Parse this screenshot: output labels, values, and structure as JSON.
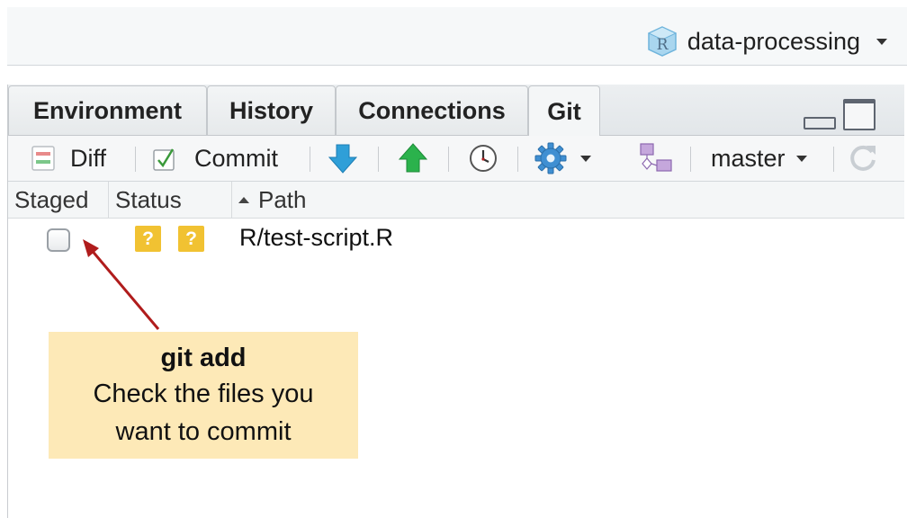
{
  "project": {
    "name": "data-processing",
    "icon": "r-project-cube-icon"
  },
  "tabs": [
    {
      "label": "Environment",
      "active": false
    },
    {
      "label": "History",
      "active": false
    },
    {
      "label": "Connections",
      "active": false
    },
    {
      "label": "Git",
      "active": true
    }
  ],
  "toolbar": {
    "diff_label": "Diff",
    "commit_label": "Commit",
    "pull_icon": "pull-arrow-down-icon",
    "push_icon": "push-arrow-up-icon",
    "history_icon": "clock-icon",
    "more_icon": "gear-icon",
    "new_branch_icon": "branch-icon",
    "branch_label": "master",
    "refresh_icon": "refresh-icon"
  },
  "table": {
    "headers": {
      "staged": "Staged",
      "status": "Status",
      "path": "Path"
    },
    "rows": [
      {
        "staged": false,
        "status": [
          "?",
          "?"
        ],
        "path": "R/test-script.R"
      }
    ]
  },
  "annotation": {
    "title": "git add",
    "line1": "Check the files you",
    "line2": "want to commit"
  },
  "colors": {
    "status_badge": "#f1c232",
    "callout_bg": "#fde9b7",
    "arrow": "#b01c1c",
    "push_green": "#2bb24c",
    "pull_blue": "#2f9fd8"
  }
}
